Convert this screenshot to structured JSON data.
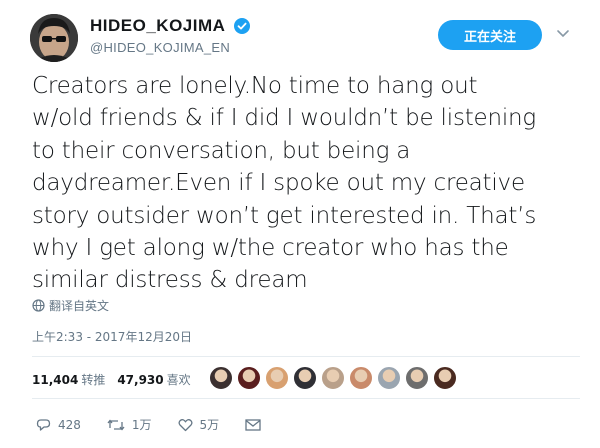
{
  "author": {
    "display_name": "HIDEO_KOJIMA",
    "handle": "@HIDEO_KOJIMA_EN",
    "verified": true
  },
  "follow_button": {
    "label": "正在关注"
  },
  "tweet": {
    "lines": [
      "Creators are lonely.No time to hang out",
      "w/old friends & if I did I wouldn’t be listening",
      "to their conversation, but being a",
      "daydreamer.Even if I spoke out my creative",
      "story outsider won’t get interested in. That’s",
      "why I get along w/the creator who has the",
      "similar distress & dream"
    ]
  },
  "translate_label": "翻译自英文",
  "timestamp": "上午2:33 - 2017年12月20日",
  "stats": {
    "retweets_count": "11,404",
    "retweets_label": "转推",
    "likes_count": "47,930",
    "likes_label": "喜欢"
  },
  "likers": [
    {
      "name": "liker-1",
      "color": "#3b3030"
    },
    {
      "name": "liker-2",
      "color": "#5a1e1e"
    },
    {
      "name": "liker-3",
      "color": "#d8a070"
    },
    {
      "name": "liker-4",
      "color": "#2f2f35"
    },
    {
      "name": "liker-5",
      "color": "#b9a08a"
    },
    {
      "name": "liker-6",
      "color": "#c98a6a"
    },
    {
      "name": "liker-7",
      "color": "#9aa5b0"
    },
    {
      "name": "liker-8",
      "color": "#6d6d6d"
    },
    {
      "name": "liker-9",
      "color": "#4a2a20"
    }
  ],
  "actions": {
    "reply_count": "428",
    "retweet_count": "1万",
    "like_count": "5万"
  },
  "colors": {
    "accent": "#1da1f2",
    "text": "#14171a",
    "muted": "#657786",
    "divider": "#e6ecf0"
  }
}
